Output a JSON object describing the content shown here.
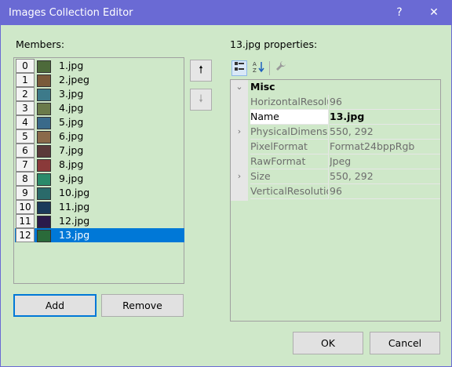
{
  "window": {
    "title": "Images Collection Editor",
    "help_label": "?",
    "close_label": "✕"
  },
  "members": {
    "label": "Members:",
    "items": [
      {
        "index": "0",
        "name": "1.jpg",
        "thumb_color": "#4d6a3a"
      },
      {
        "index": "1",
        "name": "2.jpeg",
        "thumb_color": "#7a5a3a"
      },
      {
        "index": "2",
        "name": "3.jpg",
        "thumb_color": "#3d7a8a"
      },
      {
        "index": "3",
        "name": "4.jpg",
        "thumb_color": "#6a7a4a"
      },
      {
        "index": "4",
        "name": "5.jpg",
        "thumb_color": "#3a6a8a"
      },
      {
        "index": "5",
        "name": "6.jpg",
        "thumb_color": "#8a6a4a"
      },
      {
        "index": "6",
        "name": "7.jpg",
        "thumb_color": "#5a3a3a"
      },
      {
        "index": "7",
        "name": "8.jpg",
        "thumb_color": "#8a3a3a"
      },
      {
        "index": "8",
        "name": "9.jpg",
        "thumb_color": "#2a8a6a"
      },
      {
        "index": "9",
        "name": "10.jpg",
        "thumb_color": "#2a6a6a"
      },
      {
        "index": "10",
        "name": "11.jpg",
        "thumb_color": "#1a3a5a"
      },
      {
        "index": "11",
        "name": "12.jpg",
        "thumb_color": "#2a1a4a"
      },
      {
        "index": "12",
        "name": "13.jpg",
        "thumb_color": "#2a6a3a"
      }
    ],
    "selected_index": 12
  },
  "buttons": {
    "move_up": "🠕",
    "move_down": "🠗",
    "add": "Add",
    "remove": "Remove",
    "ok": "OK",
    "cancel": "Cancel"
  },
  "properties": {
    "label": "13.jpg properties:",
    "category": "Misc",
    "rows": [
      {
        "name": "HorizontalResolution",
        "value": "96",
        "expandable": false,
        "selected": false
      },
      {
        "name": "Name",
        "value": "13.jpg",
        "expandable": false,
        "selected": true
      },
      {
        "name": "PhysicalDimension",
        "value": "550, 292",
        "expandable": true,
        "selected": false
      },
      {
        "name": "PixelFormat",
        "value": "Format24bppRgb",
        "expandable": false,
        "selected": false
      },
      {
        "name": "RawFormat",
        "value": "Jpeg",
        "expandable": false,
        "selected": false
      },
      {
        "name": "Size",
        "value": "550, 292",
        "expandable": true,
        "selected": false
      },
      {
        "name": "VerticalResolution",
        "value": "96",
        "expandable": false,
        "selected": false
      }
    ]
  },
  "icons": {
    "categorized": "categorized-icon",
    "alphabetical": "alphabetical-sort-icon",
    "property_pages": "wrench-icon"
  },
  "colors": {
    "titlebar": "#6a6ad4",
    "background": "#cfe8c9",
    "selection": "#0078d7"
  }
}
